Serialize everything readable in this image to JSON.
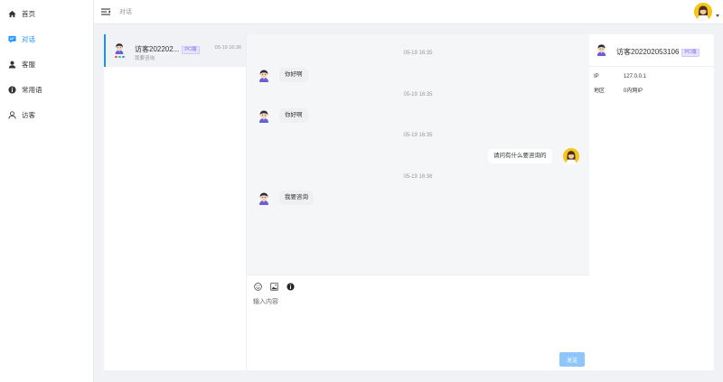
{
  "sidebar": {
    "items": [
      {
        "label": "首页",
        "icon": "home-icon"
      },
      {
        "label": "对话",
        "icon": "chat-icon",
        "active": true
      },
      {
        "label": "客服",
        "icon": "agent-icon"
      },
      {
        "label": "常用语",
        "icon": "info-icon"
      },
      {
        "label": "访客",
        "icon": "visitor-icon"
      }
    ]
  },
  "header": {
    "breadcrumb": "对话"
  },
  "conversation": {
    "name": "访客202202...",
    "badge": "PC端",
    "time": "05-19 16:36",
    "preview": "我要咨询"
  },
  "messages": {
    "items": [
      {
        "time": "05-19 16:35",
        "text": "你好啊",
        "side": "left"
      },
      {
        "time": "05-19 16:35",
        "text": "你好啊",
        "side": "left"
      },
      {
        "time": "05-19 16:35",
        "text": "请问有什么要咨询的",
        "side": "right"
      },
      {
        "time": "05-19 16:36",
        "text": "我要咨询",
        "side": "left"
      }
    ]
  },
  "composer": {
    "placeholder": "输入内容",
    "send_label": "发送"
  },
  "visitor": {
    "name": "访客202202053106",
    "badge": "PC端",
    "ip_label": "IP",
    "ip_value": "127.0.0.1",
    "region_label": "地区",
    "region_value": "0内网IP"
  },
  "colors": {
    "accent": "#1890ff",
    "send_button": "#8ec5fb",
    "badge": "#7b6cf0",
    "agent_avatar": "#f5c518"
  }
}
